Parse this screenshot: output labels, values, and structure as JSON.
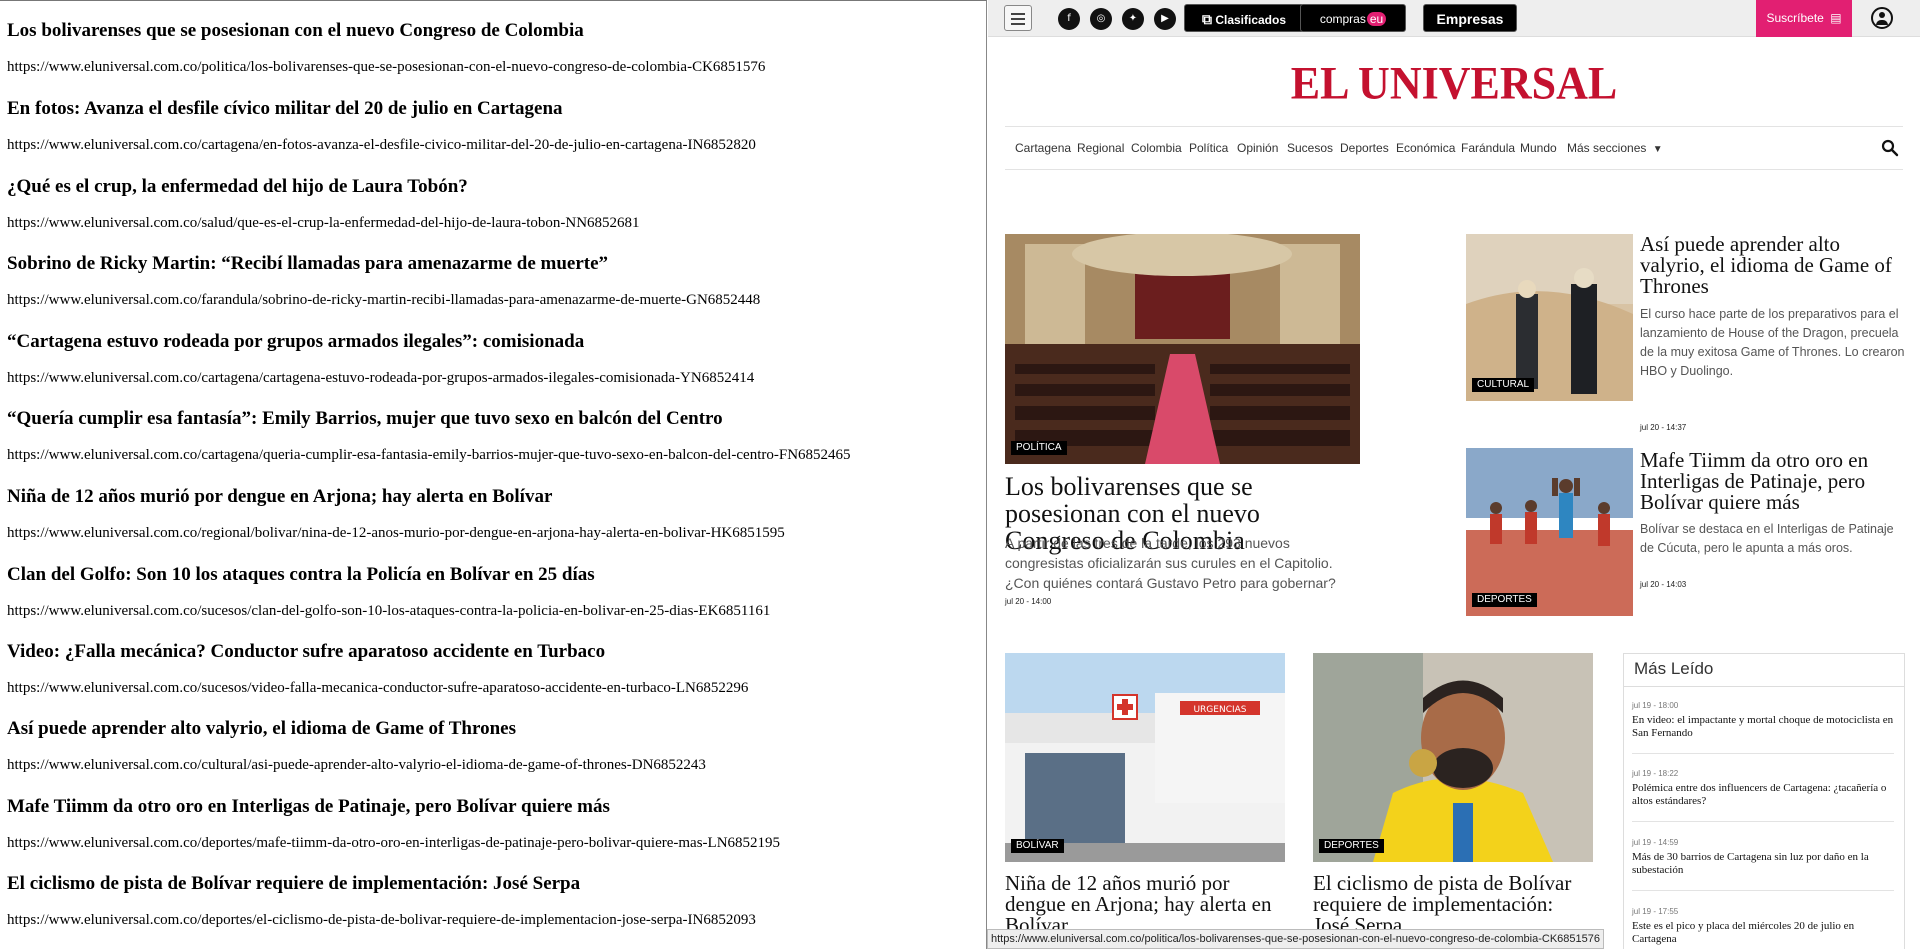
{
  "left_list": [
    {
      "title": "Los bolivarenses que se posesionan con el nuevo Congreso de Colombia",
      "url": "https://www.eluniversal.com.co/politica/los-bolivarenses-que-se-posesionan-con-el-nuevo-congreso-de-colombia-CK6851576"
    },
    {
      "title": "En fotos: Avanza el desfile cívico militar del 20 de julio en Cartagena",
      "url": "https://www.eluniversal.com.co/cartagena/en-fotos-avanza-el-desfile-civico-militar-del-20-de-julio-en-cartagena-IN6852820"
    },
    {
      "title": "¿Qué es el crup, la enfermedad del hijo de Laura Tobón?",
      "url": "https://www.eluniversal.com.co/salud/que-es-el-crup-la-enfermedad-del-hijo-de-laura-tobon-NN6852681"
    },
    {
      "title": "Sobrino de Ricky Martin: “Recibí llamadas para amenazarme de muerte”",
      "url": "https://www.eluniversal.com.co/farandula/sobrino-de-ricky-martin-recibi-llamadas-para-amenazarme-de-muerte-GN6852448"
    },
    {
      "title": "“Cartagena estuvo rodeada por grupos armados ilegales”: comisionada",
      "url": "https://www.eluniversal.com.co/cartagena/cartagena-estuvo-rodeada-por-grupos-armados-ilegales-comisionada-YN6852414"
    },
    {
      "title": "“Quería cumplir esa fantasía”: Emily Barrios, mujer que tuvo sexo en balcón del Centro",
      "url": "https://www.eluniversal.com.co/cartagena/queria-cumplir-esa-fantasia-emily-barrios-mujer-que-tuvo-sexo-en-balcon-del-centro-FN6852465"
    },
    {
      "title": "Niña de 12 años murió por dengue en Arjona; hay alerta en Bolívar",
      "url": "https://www.eluniversal.com.co/regional/bolivar/nina-de-12-anos-murio-por-dengue-en-arjona-hay-alerta-en-bolivar-HK6851595"
    },
    {
      "title": "Clan del Golfo: Son 10 los ataques contra la Policía en Bolívar en 25 días",
      "url": "https://www.eluniversal.com.co/sucesos/clan-del-golfo-son-10-los-ataques-contra-la-policia-en-bolivar-en-25-dias-EK6851161"
    },
    {
      "title": "Video: ¿Falla mecánica? Conductor sufre aparatoso accidente en Turbaco",
      "url": "https://www.eluniversal.com.co/sucesos/video-falla-mecanica-conductor-sufre-aparatoso-accidente-en-turbaco-LN6852296"
    },
    {
      "title": "Así puede aprender alto valyrio, el idioma de Game of Thrones",
      "url": "https://www.eluniversal.com.co/cultural/asi-puede-aprender-alto-valyrio-el-idioma-de-game-of-thrones-DN6852243"
    },
    {
      "title": "Mafe Tiimm da otro oro en Interligas de Patinaje, pero Bolívar quiere más",
      "url": "https://www.eluniversal.com.co/deportes/mafe-tiimm-da-otro-oro-en-interligas-de-patinaje-pero-bolivar-quiere-mas-LN6852195"
    },
    {
      "title": "El ciclismo de pista de Bolívar requiere de implementación: José Serpa",
      "url": "https://www.eluniversal.com.co/deportes/el-ciclismo-de-pista-de-bolivar-requiere-de-implementacion-jose-serpa-IN6852093"
    }
  ],
  "topbar": {
    "clasificados": "Clasificados",
    "compras": "compras",
    "compras_eu": "eu",
    "empresas": "Empresas",
    "subscribe": "Suscríbete"
  },
  "logo": "EL UNIVERSAL",
  "nav": [
    "Cartagena",
    "Regional",
    "Colombia",
    "Política",
    "Opinión",
    "Sucesos",
    "Deportes",
    "Económica",
    "Farándula",
    "Mundo",
    "Más secciones"
  ],
  "main_story": {
    "tag": "POLÍTICA",
    "title": "Los bolivarenses que se posesionan con el nuevo Congreso de Colombia",
    "summary": "A partir de las tres de la tarde, los 293 nuevos congresistas oficializarán sus curules en el Capitolio. ¿Con quiénes contará Gustavo Petro para gobernar?",
    "date": "jul 20 - 14:00"
  },
  "side_story_1": {
    "tag": "CULTURAL",
    "title": "Así puede aprender alto valyrio, el idioma de Game of Thrones",
    "summary": "El curso hace parte de los preparativos para el lanzamiento de House of the Dragon, precuela de la muy exitosa Game of Thrones. Lo crearon HBO y Duolingo.",
    "date": "jul 20 - 14:37"
  },
  "side_story_2": {
    "tag": "DEPORTES",
    "title": "Mafe Tiimm da otro oro en Interligas de Patinaje, pero Bolívar quiere más",
    "summary": "Bolívar se destaca en el Interligas de Patinaje de Cúcuta, pero le apunta a más oros.",
    "date": "jul 20 - 14:03"
  },
  "bottom_story_1": {
    "tag": "BOLÍVAR",
    "title": "Niña de 12 años murió por dengue en Arjona; hay alerta en Bolívar",
    "image_text": "URGENCIAS"
  },
  "bottom_story_2": {
    "tag": "DEPORTES",
    "title": "El ciclismo de pista de Bolívar requiere de implementación: José Serpa"
  },
  "mas_leido": {
    "title": "Más Leído",
    "items": [
      {
        "date": "jul 19 - 18:00",
        "title": "En video: el impactante y mortal choque de motociclista en San Fernando"
      },
      {
        "date": "jul 19 - 18:22",
        "title": "Polémica entre dos influencers de Cartagena: ¿tacañería o altos estándares?"
      },
      {
        "date": "jul 19 - 14:59",
        "title": "Más de 30 barrios de Cartagena sin luz por daño en la subestación"
      },
      {
        "date": "jul 19 - 17:55",
        "title": "Este es el pico y placa del miércoles 20 de julio en Cartagena"
      }
    ]
  },
  "status_bar": "https://www.eluniversal.com.co/politica/los-bolivarenses-que-se-posesionan-con-el-nuevo-congreso-de-colombia-CK6851576"
}
